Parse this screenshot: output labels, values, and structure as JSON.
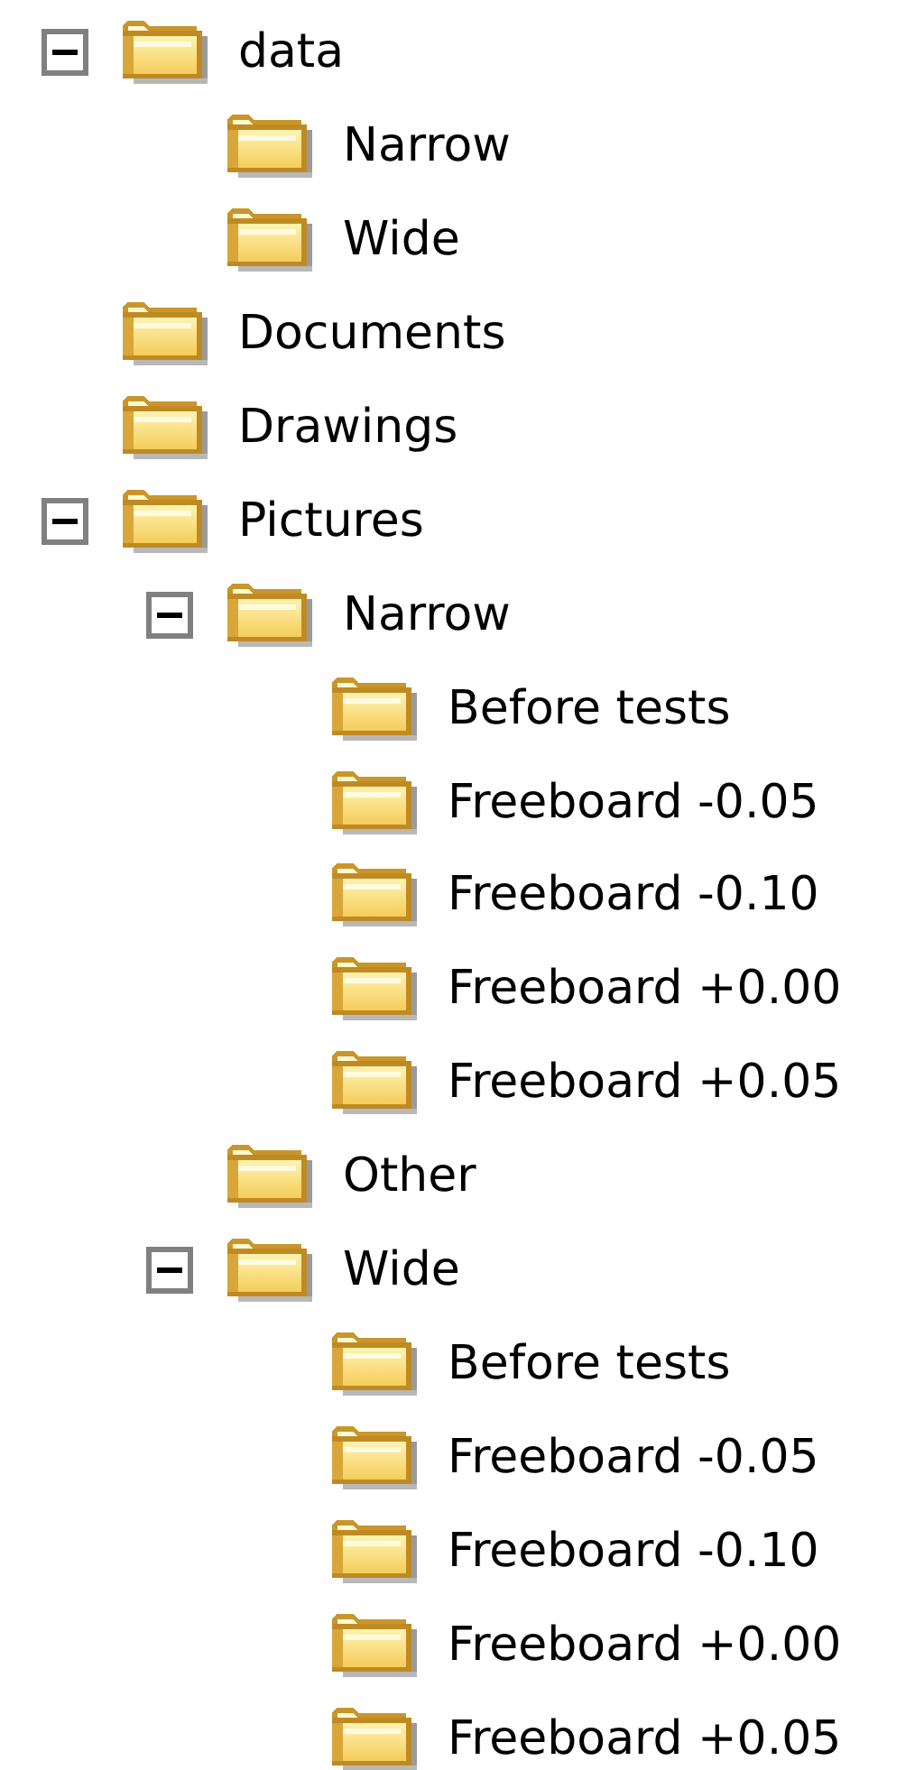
{
  "tree": [
    {
      "label": "data",
      "expanded": true,
      "children": [
        {
          "label": "Narrow"
        },
        {
          "label": "Wide"
        }
      ]
    },
    {
      "label": "Documents"
    },
    {
      "label": "Drawings"
    },
    {
      "label": "Pictures",
      "expanded": true,
      "children": [
        {
          "label": "Narrow",
          "expanded": true,
          "children": [
            {
              "label": "Before tests"
            },
            {
              "label": "Freeboard -0.05"
            },
            {
              "label": "Freeboard -0.10"
            },
            {
              "label": "Freeboard +0.00"
            },
            {
              "label": "Freeboard +0.05"
            }
          ]
        },
        {
          "label": "Other"
        },
        {
          "label": "Wide",
          "expanded": true,
          "children": [
            {
              "label": "Before tests"
            },
            {
              "label": "Freeboard -0.05"
            },
            {
              "label": "Freeboard -0.10"
            },
            {
              "label": "Freeboard +0.00"
            },
            {
              "label": "Freeboard +0.05"
            }
          ]
        }
      ]
    }
  ]
}
